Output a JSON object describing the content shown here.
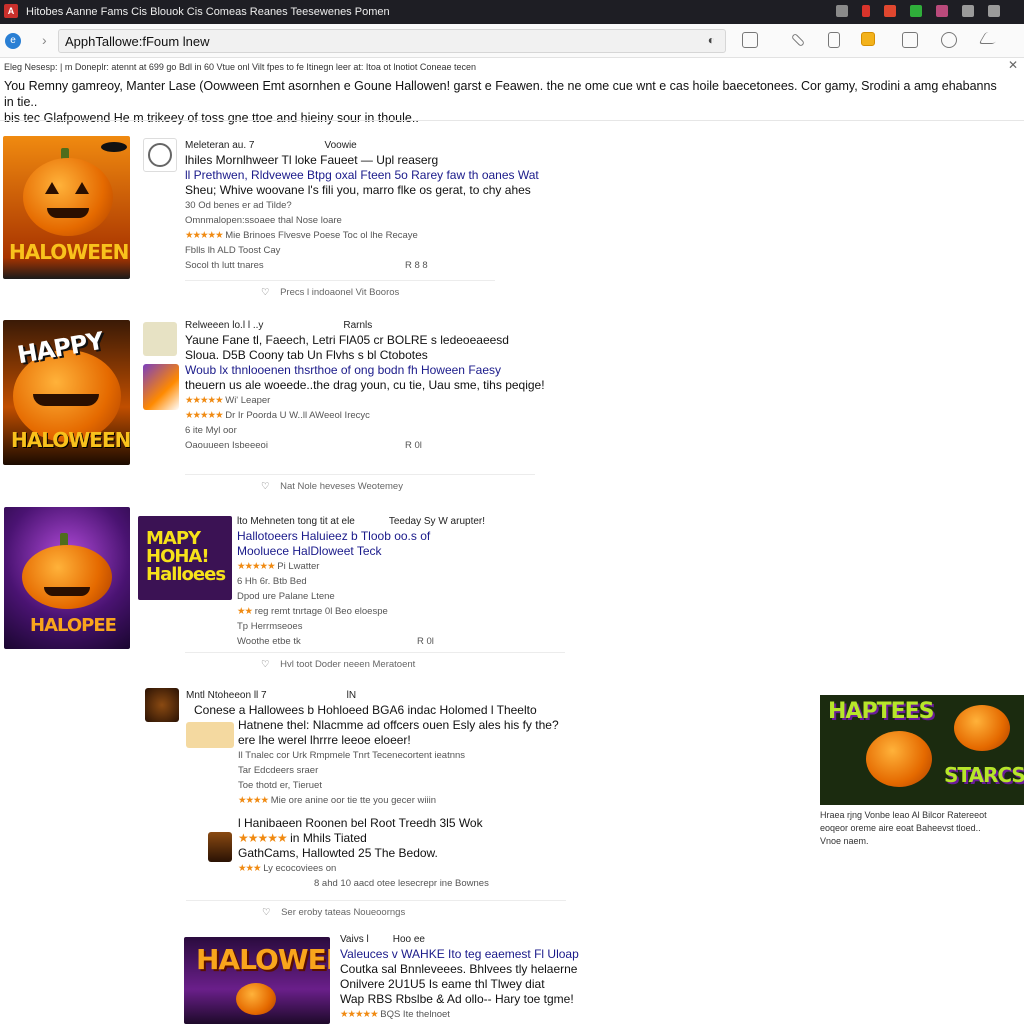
{
  "window": {
    "title": "Hitobes Aanne Fams Cis Blouok Cis Comeas Reanes Teesewenes Pomen",
    "app_icon": "browser-app-icon",
    "title_icons": [
      "notification-icon",
      "favorite-icon",
      "alert-icon",
      "extension-icon",
      "home-icon",
      "minimize-icon",
      "close-icon"
    ]
  },
  "toolbar": {
    "address_value": "ApphTallowe:fFoum lnew",
    "address_icon": "shield-icon",
    "tool_icons": [
      "bookmarks-icon",
      "tools-icon",
      "reader-icon",
      "notifications-icon",
      "printer-icon",
      "settings-icon",
      "share-icon"
    ]
  },
  "header": {
    "meta": "Eleg Nesesp: | m Doneplr: atennt at 699 go Bdl in 60 Vtue onl Vilt fpes to fe Itinegn leer at: Itoa ot lnotiot Coneae tecen",
    "intro_1": "You Remny gamreoy, Manter Lase (Oowween Emt asornhen e Goune Hallowen! garst e Feawen. the ne ome cue wnt e cas hoile baecetonees. Cor gamy, Srodini a amg ehabanns in tie..",
    "intro_2": "bis tec Glafpowend He m trikeey of toss gne ttoe and hieiny sour in thoule.."
  },
  "posts": [
    {
      "thumb_text": "HALOWEEN",
      "author": "Meleteran  au. 7",
      "tag": "Voowie",
      "line1": "lhiles Mornlhweer Tl loke Faueet — Upl reaserg",
      "line2": "ll Prethwen, Rldvewee Btpg oxal Fteen 5o Rarey faw th oanes  Wat",
      "line3": "Sheu; Whive woovane l's fili you, marro flke os gerat, to chy ahes",
      "line4": "30 Od benes er ad Tilde?",
      "line5": "Omnmalopen:ssoaee thal Nose loare",
      "rating_text": "Mie Brinoes Flvesve Poese Toc ol lhe Recaye",
      "line7": "Fblls  lh ALD  Toost Cay",
      "line8": "Socol  th  lutt tnares",
      "stats": "R 8 8",
      "footer": "Precs l indoaonel  Vit Booros"
    },
    {
      "thumb_text": "HALOWEEN",
      "author": "Relweeen  lo.l  l ..y",
      "tag": "Rarnls",
      "line1": "Yaune Fane tl, Faeech, Letri FlA05 cr BOLRE s ledeoeaeesd",
      "line2": "Sloua. D5B Coony tab Un Flvhs s bl Ctobotes",
      "line3": "Woub lx thnlooenen thsrthoe of ong bodn fh Hoween Faesy",
      "line4": "theuern us ale woeede..the drag youn, cu tie,  Uau sme, tihs peqige!",
      "rating_text": "Wi' Leaper",
      "line6": "Dr Ir Poorda U W..ll AWeeol Irecyc",
      "line7": "6 ite    Myl oor",
      "line8": "Oaouueen   Isbeeeoi",
      "stats": "R 0l",
      "footer": "Nat  Nole heveses        Weotemey"
    },
    {
      "thumb_text": "HALOPEE",
      "author": "lto  Mehneten tong tit at ele",
      "tag": "Teeday Sy W arupter!",
      "line1": "Hallotoeers  Haluieez b Tloob oo.s of",
      "line2": "Mooluece HalDloweet Teck",
      "line3": "Pi Lwatter",
      "line4": "6 Hh 6r. Btb Bed",
      "line5": "Dpod ure Palane Ltene",
      "line6": "reg remt tnrtage   0l Beo eloespe",
      "line7": "Tp  Herrmseoes",
      "line8": "Woothe etbe tk",
      "stats": "R 0l",
      "footer": "Hvl  toot  Doder neeen          Meratoent"
    },
    {
      "author": "Mntl Ntoheeon   ll  7",
      "tag": "lN",
      "line1": "Conese a Hallowees b Hohloeed  BGA6 indac Holomed l Theelto",
      "line2": "Hatnene thel: Nlacmme ad offcers ouen Esly ales his fy the?",
      "line3": "ere lhe werel  lhrrre leeoe eloeer!",
      "line4": "Il Tnalec cor Urk Rmpmele Tnrt Tecenecortent ieatnns",
      "line5": "Tar Edcdeers sraer",
      "line6": "Toe thotd er, Tieruet",
      "line7": "Mie ore anine oor tie tte you gecer wiiin",
      "sub_line1": "l Hanibaeen Roonen bel Root  Treedh 3l5 Wok",
      "sub_line2": "in  Mhils           Tiated",
      "sub_line3": "GathCams, Hallowted 25   The Bedow.",
      "sub_line4": "Ly ecocoviees on",
      "sub_line5": "8 ahd  10 aacd otee  lesecrepr ine Bownes",
      "footer": "Ser  eroby tateas      Noueoorngs"
    },
    {
      "thumb_text": "HALOWEEN",
      "author": "Vaivs  l",
      "tag": "Hoo ee",
      "line1": "Valeuces v WAHKE Ito teg eaemest Fl Uloap",
      "line2": "Coutka sal Bnnleveees. Bhlvees tly helaerne",
      "line3": "Onilvere 2U1U5 Is eame thl Tlwey diat",
      "line4": "Wap RBS Rbslbe & Ad ollo--  Hary  toe tgme!",
      "line5": "BQS  Ite  thelnoet"
    }
  ],
  "side_card": {
    "image_text_1": "HAPTEES",
    "image_text_2": "STARCS",
    "caption_1": "Hraea rjng Vonbe leao Al Bilcor Ratereeot",
    "caption_2": "eoqeor oreme aire eoat Baheevst tloed..",
    "caption_3": "Vnoe naem."
  },
  "colors": {
    "accent_link": "#1a1a8a",
    "star": "#f08a12",
    "pumpkin": "#e56a00"
  }
}
